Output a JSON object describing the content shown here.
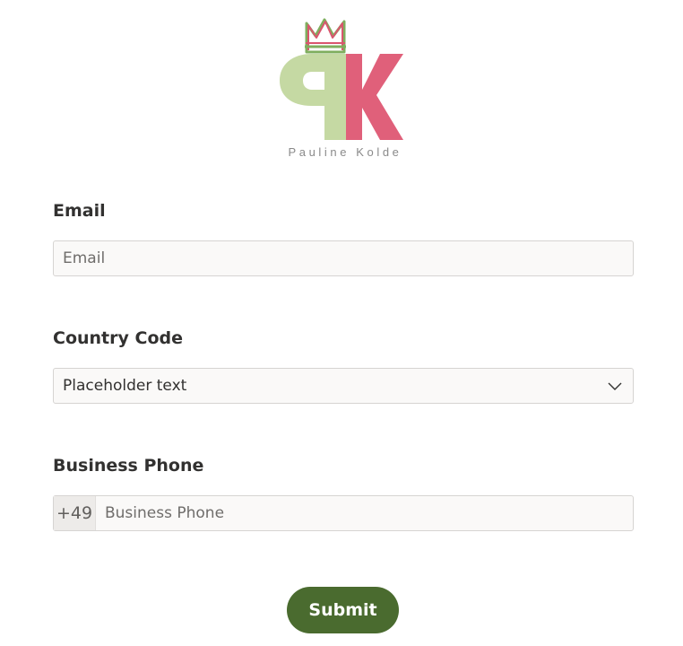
{
  "logo": {
    "text": "Pauline Kolde",
    "colors": {
      "green": "#c5d9a3",
      "pink": "#e0607a",
      "crown_green": "#7fae5e",
      "crown_pink": "#d9566e"
    }
  },
  "form": {
    "email": {
      "label": "Email",
      "placeholder": "Email",
      "value": ""
    },
    "country_code": {
      "label": "Country Code",
      "selected": "Placeholder text"
    },
    "business_phone": {
      "label": "Business Phone",
      "prefix": "+49",
      "placeholder": "Business Phone",
      "value": ""
    },
    "submit_label": "Submit"
  },
  "colors": {
    "submit_bg": "#4a6b2f",
    "input_bg": "#faf9f8",
    "input_border": "#d6d4d2",
    "label_text": "#323130"
  }
}
